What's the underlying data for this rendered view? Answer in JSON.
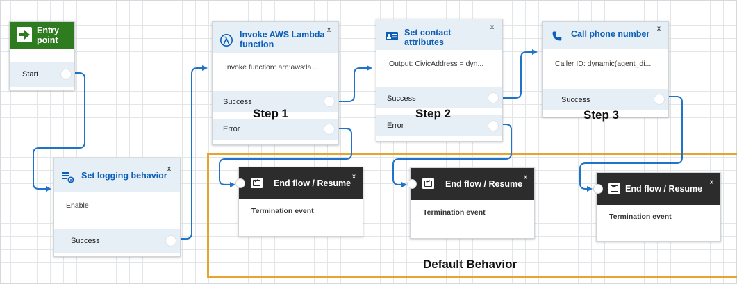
{
  "entry": {
    "title_line1": "Entry",
    "title_line2": "point",
    "start_label": "Start"
  },
  "logging": {
    "title": "Set logging behavior",
    "close": "x",
    "desc": "Enable",
    "success": "Success"
  },
  "lambda": {
    "title_line1": "Invoke AWS Lambda",
    "title_line2": "function",
    "close": "x",
    "desc": "Invoke function: arn:aws:la...",
    "success": "Success",
    "error": "Error"
  },
  "contact": {
    "title_line1": "Set contact",
    "title_line2": "attributes",
    "close": "x",
    "desc": "Output: CivicAddress = dyn...",
    "success": "Success",
    "error": "Error"
  },
  "phone": {
    "title": "Call phone number",
    "close": "x",
    "desc": "Caller ID: dynamic(agent_di...",
    "success": "Success"
  },
  "end_blocks": [
    {
      "title": "End flow / Resume",
      "close": "x",
      "desc": "Termination event"
    },
    {
      "title": "End flow / Resume",
      "close": "x",
      "desc": "Termination event"
    },
    {
      "title": "End flow / Resume",
      "close": "x",
      "desc": "Termination event"
    }
  ],
  "steps": [
    "Step 1",
    "Step 2",
    "Step 3"
  ],
  "default_behavior_label": "Default Behavior",
  "colors": {
    "connector": "#1f73c8",
    "accent_blue": "#0a5fb8",
    "entry_green": "#2f7b1f",
    "highlight_orange": "#e6a431",
    "end_header": "#2c2c2c"
  },
  "icons": [
    "entry-arrow-icon",
    "logging-icon",
    "lambda-icon",
    "contact-attributes-icon",
    "phone-icon",
    "end-flow-icon"
  ]
}
